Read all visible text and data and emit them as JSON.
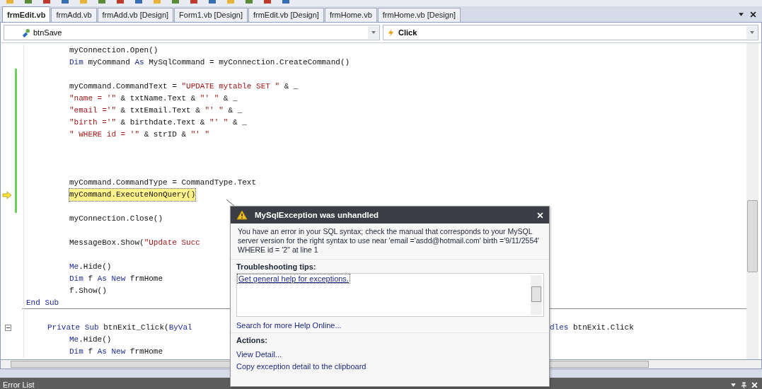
{
  "tabs": [
    {
      "label": "frmEdit.vb",
      "selected": true
    },
    {
      "label": "frmAdd.vb",
      "selected": false
    },
    {
      "label": "frmAdd.vb [Design]",
      "selected": false
    },
    {
      "label": "Form1.vb [Design]",
      "selected": false
    },
    {
      "label": "frmEdit.vb [Design]",
      "selected": false
    },
    {
      "label": "frmHome.vb",
      "selected": false
    },
    {
      "label": "frmHome.vb [Design]",
      "selected": false
    }
  ],
  "object_combo": {
    "value": "btnSave"
  },
  "event_combo": {
    "value": "Click"
  },
  "code_lines": [
    {
      "kind": "body",
      "tokens": [
        {
          "kind": "plain",
          "text": "myConnection.Open()"
        }
      ]
    },
    {
      "kind": "body",
      "tokens": [
        {
          "kind": "keyword",
          "text": "Dim"
        },
        {
          "kind": "plain",
          "text": " myCommand "
        },
        {
          "kind": "keyword",
          "text": "As"
        },
        {
          "kind": "plain",
          "text": " MySqlCommand = myConnection.CreateCommand()"
        }
      ]
    },
    {
      "kind": "blank",
      "changed": true
    },
    {
      "kind": "body",
      "changed": true,
      "tokens": [
        {
          "kind": "plain",
          "text": "myCommand.CommandText = "
        },
        {
          "kind": "string",
          "text": "\"UPDATE mytable SET \""
        },
        {
          "kind": "plain",
          "text": " & _"
        }
      ]
    },
    {
      "kind": "body",
      "changed": true,
      "tokens": [
        {
          "kind": "string",
          "text": "\"name = '\""
        },
        {
          "kind": "plain",
          "text": " & txtName.Text & "
        },
        {
          "kind": "string",
          "text": "\"' \""
        },
        {
          "kind": "plain",
          "text": " & _"
        }
      ]
    },
    {
      "kind": "body",
      "changed": true,
      "tokens": [
        {
          "kind": "string",
          "text": "\"email ='\""
        },
        {
          "kind": "plain",
          "text": " & txtEmail.Text & "
        },
        {
          "kind": "string",
          "text": "\"' \""
        },
        {
          "kind": "plain",
          "text": " & _"
        }
      ]
    },
    {
      "kind": "body",
      "changed": true,
      "tokens": [
        {
          "kind": "string",
          "text": "\"birth ='\""
        },
        {
          "kind": "plain",
          "text": " & birthdate.Text & "
        },
        {
          "kind": "string",
          "text": "\"' \""
        },
        {
          "kind": "plain",
          "text": " & _"
        }
      ]
    },
    {
      "kind": "body",
      "changed": true,
      "tokens": [
        {
          "kind": "string",
          "text": "\" WHERE id = '\""
        },
        {
          "kind": "plain",
          "text": " & strID & "
        },
        {
          "kind": "string",
          "text": "\"' \""
        }
      ]
    },
    {
      "kind": "blank",
      "changed": true
    },
    {
      "kind": "blank",
      "changed": true
    },
    {
      "kind": "blank",
      "changed": true
    },
    {
      "kind": "body",
      "changed": true,
      "tokens": [
        {
          "kind": "plain",
          "text": "myCommand.CommandType = CommandType.Text"
        }
      ]
    },
    {
      "kind": "body",
      "changed": true,
      "current": true,
      "tokens": [
        {
          "kind": "plain",
          "text": "myCommand.ExecuteNonQuery()"
        }
      ]
    },
    {
      "kind": "blank",
      "changed": true
    },
    {
      "kind": "body",
      "tokens": [
        {
          "kind": "plain",
          "text": "myConnection.Close()"
        }
      ]
    },
    {
      "kind": "blank"
    },
    {
      "kind": "body",
      "tokens": [
        {
          "kind": "plain",
          "text": "MessageBox.Show("
        },
        {
          "kind": "string",
          "text": "\"Update Succ"
        }
      ]
    },
    {
      "kind": "blank"
    },
    {
      "kind": "body",
      "tokens": [
        {
          "kind": "keyword",
          "text": "Me"
        },
        {
          "kind": "plain",
          "text": ".Hide()"
        }
      ]
    },
    {
      "kind": "body",
      "tokens": [
        {
          "kind": "keyword",
          "text": "Dim"
        },
        {
          "kind": "plain",
          "text": " f "
        },
        {
          "kind": "keyword",
          "text": "As New"
        },
        {
          "kind": "plain",
          "text": " frmHome"
        }
      ]
    },
    {
      "kind": "body",
      "tokens": [
        {
          "kind": "plain",
          "text": "f.Show()"
        }
      ]
    },
    {
      "kind": "member_end",
      "tokens": [
        {
          "kind": "keyword",
          "text": "End Sub"
        }
      ]
    },
    {
      "kind": "blank"
    },
    {
      "kind": "member",
      "tokens": [
        {
          "kind": "keyword",
          "text": "Private Sub"
        },
        {
          "kind": "plain",
          "text": " btnExit_Click("
        },
        {
          "kind": "keyword",
          "text": "ByVal"
        }
      ],
      "tail_tokens": [
        {
          "kind": "keyword",
          "text": "dles"
        },
        {
          "kind": "plain",
          "text": " btnExit.Click"
        }
      ]
    },
    {
      "kind": "body",
      "tokens": [
        {
          "kind": "keyword",
          "text": "Me"
        },
        {
          "kind": "plain",
          "text": ".Hide()"
        }
      ]
    },
    {
      "kind": "body",
      "tokens": [
        {
          "kind": "keyword",
          "text": "Dim"
        },
        {
          "kind": "plain",
          "text": " f "
        },
        {
          "kind": "keyword",
          "text": "As New"
        },
        {
          "kind": "plain",
          "text": " frmHome"
        }
      ]
    }
  ],
  "exception": {
    "title": "MySqlException was unhandled",
    "message": "You have an error in your SQL syntax; check the manual that corresponds to your MySQL server version for the right syntax to use near 'email ='asdd@hotmail.com' birth ='9/11/2554'  WHERE id = '2'' at line 1",
    "tips_heading": "Troubleshooting tips:",
    "tips": [
      "Get general help for exceptions."
    ],
    "search_link": "Search for more Help Online...",
    "actions_heading": "Actions:",
    "actions": [
      "View Detail...",
      "Copy exception detail to the clipboard"
    ]
  },
  "bottom_panel": {
    "title": "Error List"
  }
}
